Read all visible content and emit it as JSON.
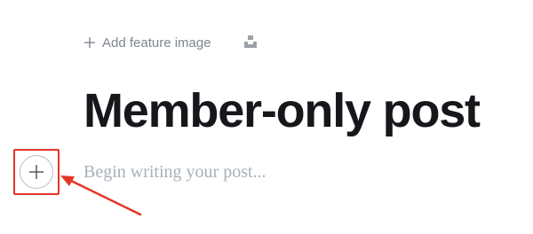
{
  "editor": {
    "feature_image_label": "Add feature image",
    "unsplash_icon": "unsplash-icon",
    "title": "Member-only post",
    "body_placeholder": "Begin writing your post...",
    "card_button_icon": "plus-icon"
  },
  "annotation": {
    "color": "#e53528"
  },
  "colors": {
    "title": "#15171a",
    "muted": "#7d8590",
    "placeholder": "#a8b0b9"
  }
}
